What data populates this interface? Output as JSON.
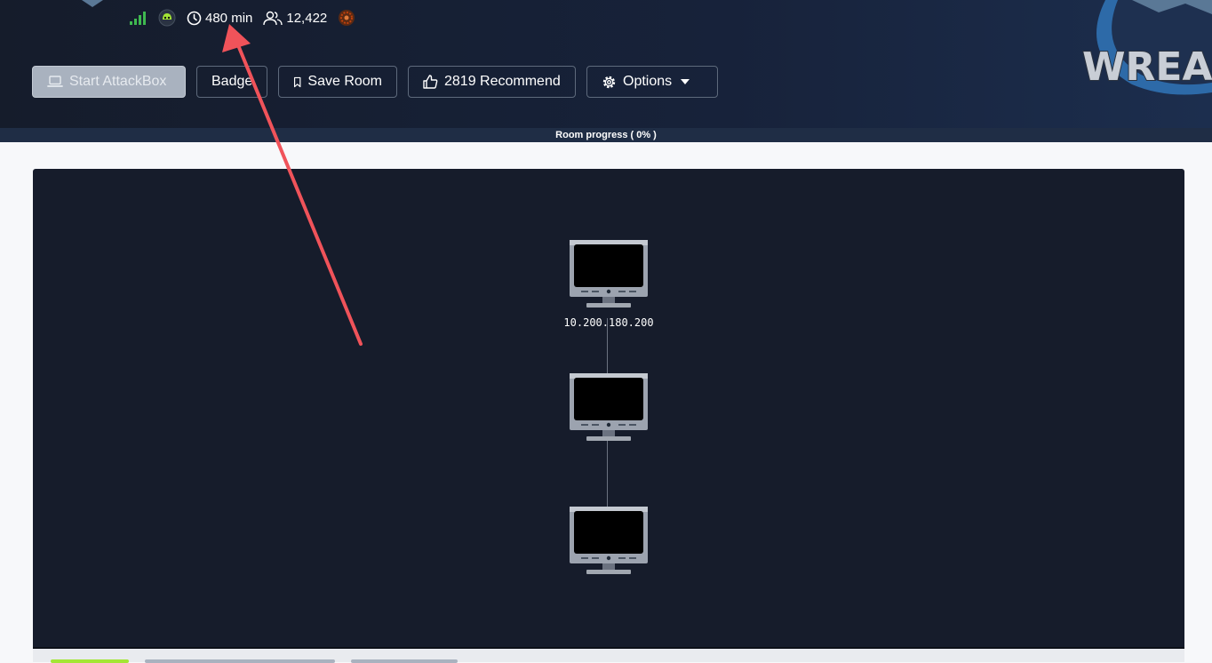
{
  "stats": {
    "duration": "480 min",
    "users": "12,422"
  },
  "toolbar": {
    "attackbox_label": "Start AttackBox",
    "badge_label": "Badge",
    "save_label": "Save Room",
    "recommend_label": "2819 Recommend",
    "options_label": "Options"
  },
  "progress": {
    "label": "Room progress ( 0% )",
    "value": 0
  },
  "network": {
    "nodes": [
      {
        "ip": "10.200.180.200"
      },
      {
        "ip": ""
      },
      {
        "ip": ""
      }
    ]
  },
  "banner": {
    "text": "WREA"
  },
  "colors": {
    "header_bg": "#151c2b",
    "network_bg": "#161c2b",
    "annotation_arrow": "#f0535a",
    "signal_green": "#3fb950"
  },
  "icons": [
    "signal-icon",
    "difficulty-icon",
    "clock-icon",
    "users-icon",
    "badge-icon",
    "laptop-icon",
    "bookmark-icon",
    "thumbs-up-icon",
    "gear-icon",
    "caret-down-icon",
    "monitor-icon"
  ]
}
